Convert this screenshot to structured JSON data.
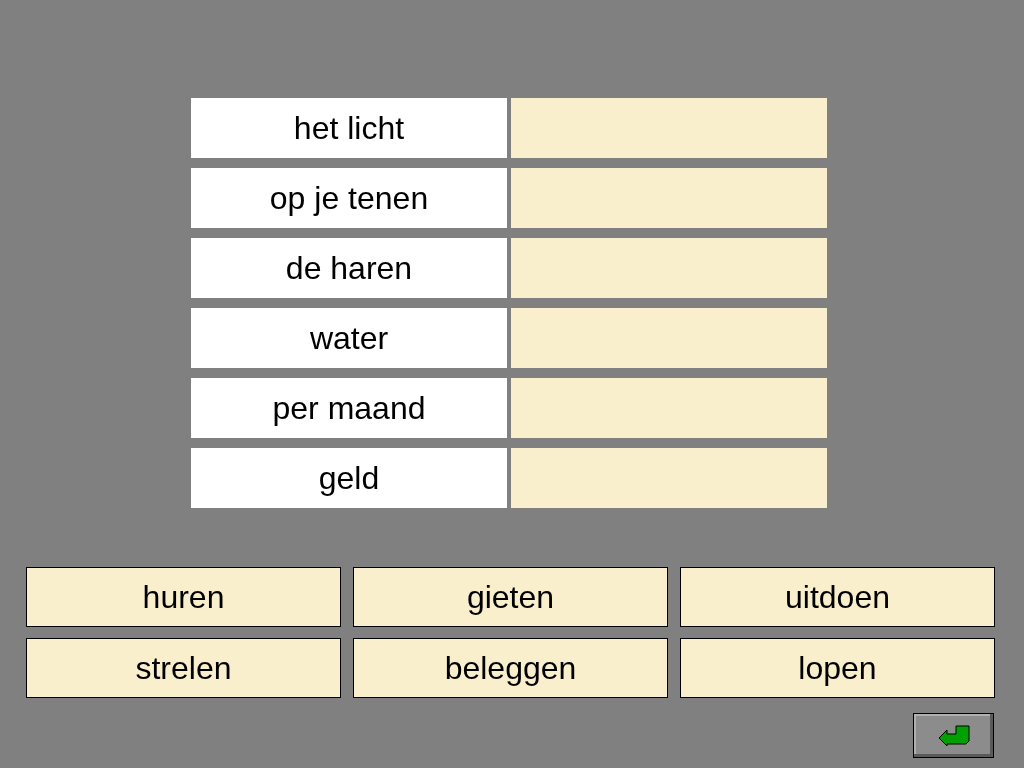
{
  "pairs": [
    {
      "prompt": "het licht"
    },
    {
      "prompt": "op je tenen"
    },
    {
      "prompt": "de haren"
    },
    {
      "prompt": "water"
    },
    {
      "prompt": "per maand"
    },
    {
      "prompt": "geld"
    }
  ],
  "word_tiles": [
    "huren",
    "gieten",
    "uitdoen",
    "strelen",
    "beleggen",
    "lopen"
  ]
}
